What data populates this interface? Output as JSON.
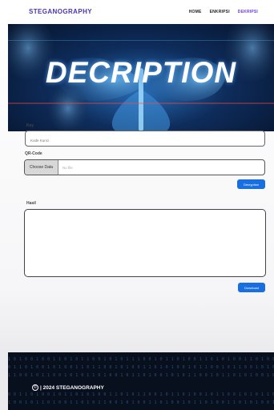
{
  "nav": {
    "brand": "STEGANOGRAPHY",
    "links": [
      {
        "label": "HOME"
      },
      {
        "label": "ENKRIPSI"
      },
      {
        "label": "DEKRIPSI"
      }
    ]
  },
  "hero": {
    "title": "DECRIPTION"
  },
  "form": {
    "key_label": "Key",
    "key_placeholder": "Kode Kunci",
    "qr_label": "QR-Code",
    "choose_file_label": "Choose Data",
    "file_status": "No file",
    "decrypt_label": "Decryption",
    "result_label": "Hasil",
    "download_label": "Download"
  },
  "footer": {
    "copyright_symbol": "©",
    "copyright_text": "| 2024 STEGANOGRAPHY"
  },
  "colors": {
    "brand": "#4b33b8",
    "active_link": "#6a3de0",
    "button_blue": "#1a6fe0",
    "footer_bg": "#08101e"
  }
}
